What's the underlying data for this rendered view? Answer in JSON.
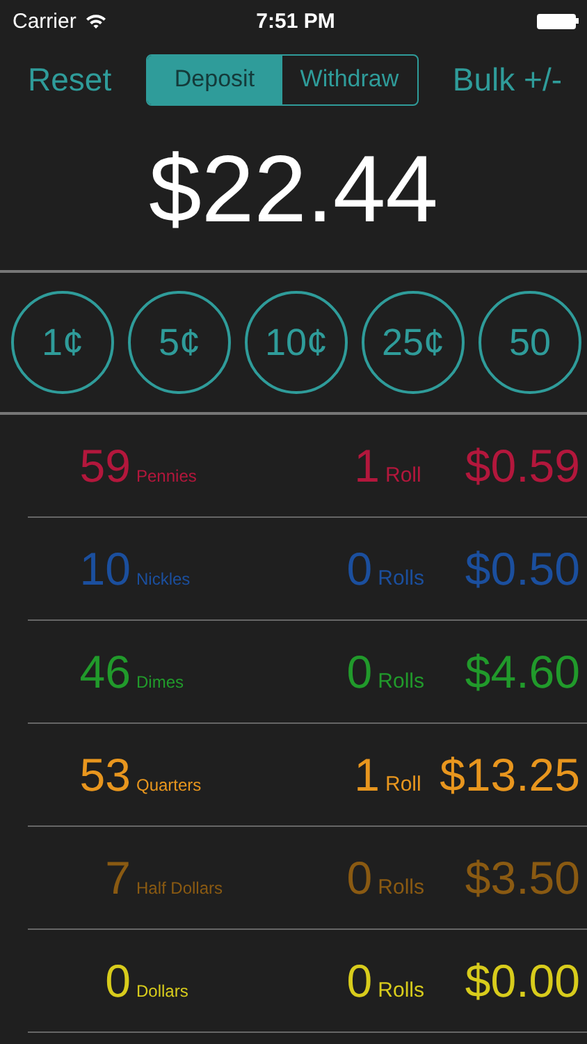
{
  "status_bar": {
    "carrier": "Carrier",
    "time": "7:51 PM"
  },
  "nav": {
    "left": "Reset",
    "right": "Bulk +/-",
    "segments": [
      {
        "label": "Deposit",
        "selected": true
      },
      {
        "label": "Withdraw",
        "selected": false
      }
    ]
  },
  "total": "$22.44",
  "coin_buttons": [
    "1¢",
    "5¢",
    "10¢",
    "25¢",
    "50"
  ],
  "rows": [
    {
      "count": "59",
      "coin": "Pennies",
      "rolls": "1",
      "rolls_label": "Roll",
      "amount": "$0.59",
      "color": "#b3173c"
    },
    {
      "count": "10",
      "coin": "Nickles",
      "rolls": "0",
      "rolls_label": "Rolls",
      "amount": "$0.50",
      "color": "#1b4f9e"
    },
    {
      "count": "46",
      "coin": "Dimes",
      "rolls": "0",
      "rolls_label": "Rolls",
      "amount": "$4.60",
      "color": "#219a2b"
    },
    {
      "count": "53",
      "coin": "Quarters",
      "rolls": "1",
      "rolls_label": "Roll",
      "amount": "$13.25",
      "color": "#e8961e"
    },
    {
      "count": "7",
      "coin": "Half Dollars",
      "rolls": "0",
      "rolls_label": "Rolls",
      "amount": "$3.50",
      "color": "#8a5a12"
    },
    {
      "count": "0",
      "coin": "Dollars",
      "rolls": "0",
      "rolls_label": "Rolls",
      "amount": "$0.00",
      "color": "#d8cc1c"
    }
  ]
}
